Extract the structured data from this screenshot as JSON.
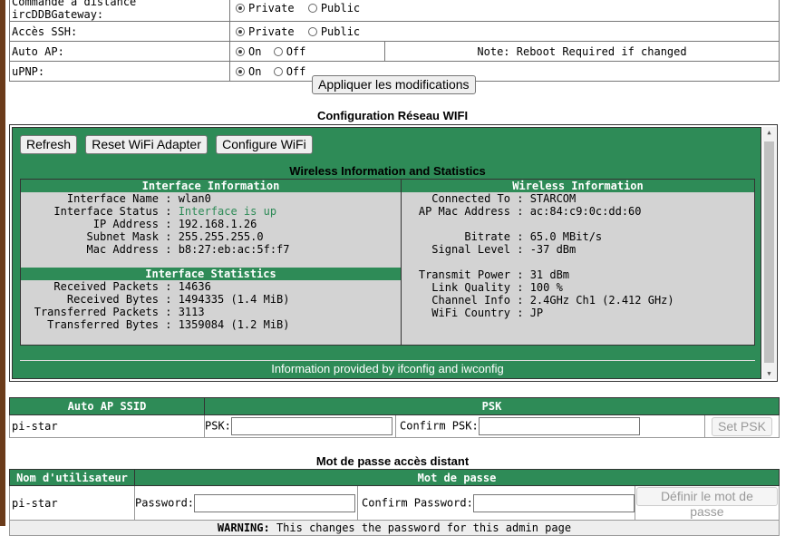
{
  "settings": {
    "rows": [
      {
        "label": "Commande à distance ircDDBGateway:",
        "opt1": "Private",
        "opt2": "Public"
      },
      {
        "label": "Accès SSH:",
        "opt1": "Private",
        "opt2": "Public"
      },
      {
        "label": "Auto AP:",
        "opt1": "On",
        "opt2": "Off",
        "note": "Note: Reboot Required if changed"
      },
      {
        "label": "uPNP:",
        "opt1": "On",
        "opt2": "Off"
      }
    ],
    "apply_label": "Appliquer les modifications"
  },
  "wifi": {
    "title": "Configuration Réseau WIFI",
    "buttons": {
      "refresh": "Refresh",
      "reset": "Reset WiFi Adapter",
      "configure": "Configure WiFi"
    },
    "heading": "Wireless Information and Statistics",
    "iface_info": {
      "header": "Interface Information",
      "rows": [
        {
          "k": "Interface Name",
          "v": "wlan0"
        },
        {
          "k": "Interface Status",
          "v": "Interface is up"
        },
        {
          "k": "IP Address",
          "v": "192.168.1.26"
        },
        {
          "k": "Subnet Mask",
          "v": "255.255.255.0"
        },
        {
          "k": "Mac Address",
          "v": "b8:27:eb:ac:5f:f7"
        }
      ]
    },
    "iface_stats": {
      "header": "Interface Statistics",
      "rows": [
        {
          "k": "Received Packets",
          "v": "14636"
        },
        {
          "k": "Received Bytes",
          "v": "1494335 (1.4 MiB)"
        },
        {
          "k": "Transferred Packets",
          "v": "3113"
        },
        {
          "k": "Transferred Bytes",
          "v": "1359084 (1.2 MiB)"
        }
      ]
    },
    "wireless_info": {
      "header": "Wireless Information",
      "rows": [
        {
          "k": "Connected To",
          "v": "STARCOM"
        },
        {
          "k": "AP Mac Address",
          "v": "ac:84:c9:0c:dd:60"
        },
        {
          "k": "Bitrate",
          "v": "65.0 MBit/s"
        },
        {
          "k": "Signal Level",
          "v": "-37 dBm"
        },
        {
          "k": "Transmit Power",
          "v": "31 dBm"
        },
        {
          "k": "Link Quality",
          "v": "100 %"
        },
        {
          "k": "Channel Info",
          "v": "2.4GHz Ch1 (2.412 GHz)"
        },
        {
          "k": "WiFi Country",
          "v": "JP"
        }
      ]
    },
    "footer": "Information provided by ifconfig and iwconfig",
    "status_color": "#2e8b57"
  },
  "autoap": {
    "col_ssid": "Auto AP SSID",
    "col_psk": "PSK",
    "ssid_value": "pi-star",
    "psk_label": "PSK:",
    "confirm_label": "Confirm PSK:",
    "set_label": "Set PSK"
  },
  "password": {
    "title": "Mot de passe accès distant",
    "col_user": "Nom d'utilisateur",
    "col_pass": "Mot de passe",
    "user_value": "pi-star",
    "pass_label": "Password:",
    "confirm_label": "Confirm Password:",
    "define_label": "Définir le mot de passe",
    "warning_label": "WARNING:",
    "warning_text": " This changes the password for this admin page"
  },
  "colors": {
    "accent": "#2e8b57",
    "grey": "#d3d3d3"
  }
}
